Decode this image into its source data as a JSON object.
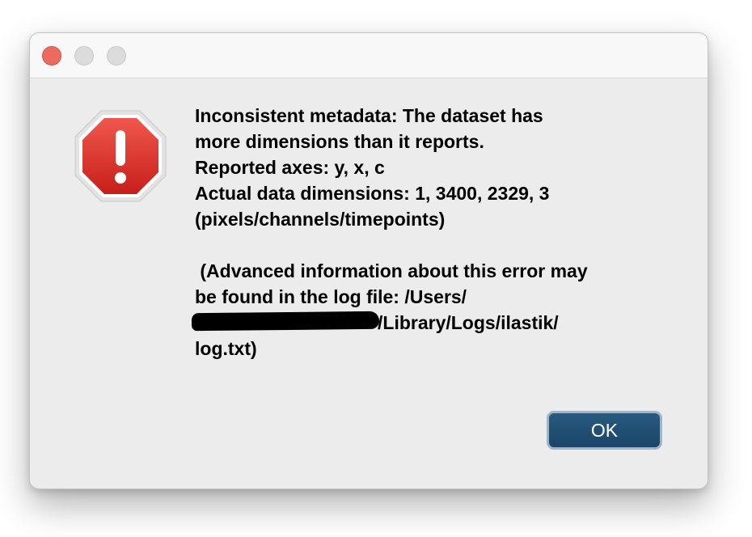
{
  "dialog": {
    "message_lines": [
      "Inconsistent metadata: The dataset has",
      "more dimensions than it reports.",
      "Reported axes: y, x, c",
      "Actual data dimensions: 1, 3400, 2329, 3",
      "(pixels/channels/timepoints)",
      " (Advanced information about this error may",
      "be found in the log file: /Users/",
      "/Library/Logs/ilastik/",
      "log.txt)"
    ],
    "ok_label": "OK"
  },
  "icons": {
    "error": "stop-sign-exclamation-icon"
  },
  "colors": {
    "close_button": "#ed6a5e",
    "inactive_button": "#dcdcdc",
    "ok_button": "#1f4b70",
    "error_icon": "#d8302a"
  }
}
